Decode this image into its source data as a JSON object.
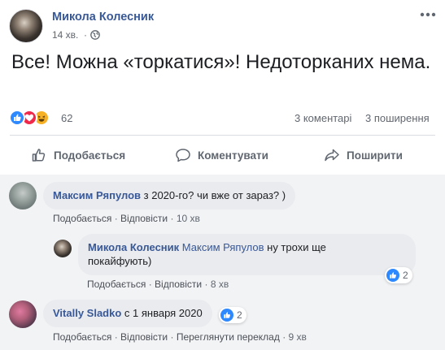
{
  "post": {
    "author": "Микола Колесник",
    "time": "14 хв.",
    "dot": "·",
    "text": "Все! Можна «торкатися»! Недоторканих нема.",
    "reaction_count": "62",
    "comments": "3 коментарі",
    "shares": "3 поширення",
    "reactions": [
      "like",
      "love",
      "haha"
    ]
  },
  "actions": {
    "like": "Подобається",
    "comment": "Коментувати",
    "share": "Поширити"
  },
  "comments": [
    {
      "author": "Максим Ряпулов",
      "text": " з 2020-го? чи вже от зараз? )",
      "like": "Подобається",
      "reply": "Відповісти",
      "time": "10 хв"
    },
    {
      "author": "Микола Колесник",
      "mention": "Максим Ряпулов",
      "text_line1": " ну трохи ще",
      "text_line2": "покайфують)",
      "like": "Подобається",
      "reply": "Відповісти",
      "time": "8 хв",
      "reactions": "2"
    },
    {
      "author": "Vitally Sladko",
      "text": " с 1 января 2020",
      "like": "Подобається",
      "reply": "Відповісти",
      "translate": "Переглянути переклад",
      "time": "9 хв",
      "reactions": "2"
    }
  ],
  "separator": "·",
  "colors": {
    "link": "#385898",
    "like_blue": "#2e89ff",
    "love_red": "#f0284a",
    "haha_yellow": "#f7b125",
    "bubble": "#e9ebee"
  },
  "icons": [
    "globe-icon",
    "more-icon",
    "like-icon",
    "comment-icon",
    "share-icon"
  ]
}
